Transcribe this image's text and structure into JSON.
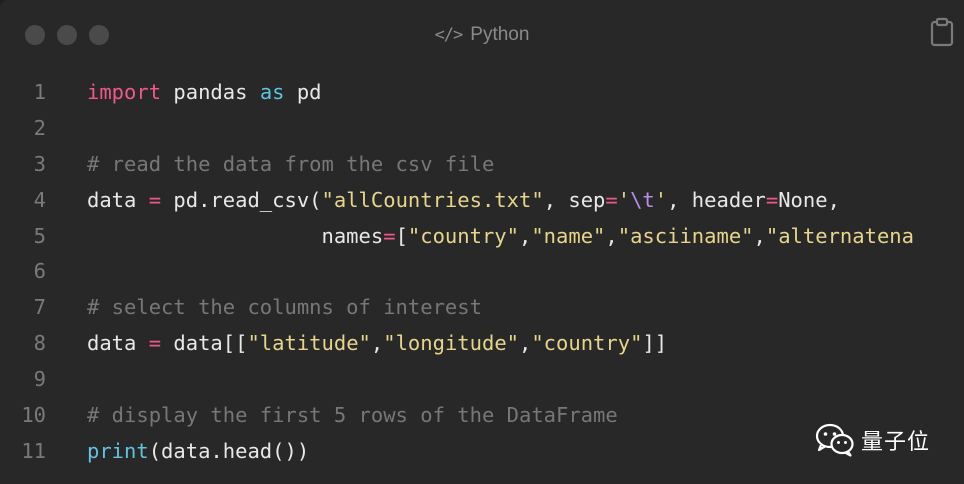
{
  "window": {
    "language": "Python",
    "code_icon": "code-icon",
    "copy_icon": "clipboard-icon"
  },
  "code": {
    "lines": [
      {
        "num": "1",
        "tokens": [
          {
            "t": "import",
            "c": "kw"
          },
          {
            "t": " pandas ",
            "c": ""
          },
          {
            "t": "as",
            "c": "kw2"
          },
          {
            "t": " pd",
            "c": ""
          }
        ]
      },
      {
        "num": "2",
        "tokens": []
      },
      {
        "num": "3",
        "tokens": [
          {
            "t": "# read the data from the csv file",
            "c": "cm"
          }
        ]
      },
      {
        "num": "4",
        "tokens": [
          {
            "t": "data ",
            "c": ""
          },
          {
            "t": "=",
            "c": "op"
          },
          {
            "t": " pd.read_csv(",
            "c": ""
          },
          {
            "t": "\"allCountries.txt\"",
            "c": "str"
          },
          {
            "t": ", sep",
            "c": ""
          },
          {
            "t": "=",
            "c": "op"
          },
          {
            "t": "'",
            "c": "str"
          },
          {
            "t": "\\t",
            "c": "esc"
          },
          {
            "t": "'",
            "c": "str"
          },
          {
            "t": ", header",
            "c": ""
          },
          {
            "t": "=",
            "c": "op"
          },
          {
            "t": "None,",
            "c": ""
          }
        ]
      },
      {
        "num": "5",
        "tokens": [
          {
            "t": "                   names",
            "c": ""
          },
          {
            "t": "=",
            "c": "op"
          },
          {
            "t": "[",
            "c": ""
          },
          {
            "t": "\"country\"",
            "c": "str"
          },
          {
            "t": ",",
            "c": ""
          },
          {
            "t": "\"name\"",
            "c": "str"
          },
          {
            "t": ",",
            "c": ""
          },
          {
            "t": "\"asciiname\"",
            "c": "str"
          },
          {
            "t": ",",
            "c": ""
          },
          {
            "t": "\"alternatena",
            "c": "str"
          }
        ]
      },
      {
        "num": "6",
        "tokens": []
      },
      {
        "num": "7",
        "tokens": [
          {
            "t": "# select the columns of interest",
            "c": "cm"
          }
        ]
      },
      {
        "num": "8",
        "tokens": [
          {
            "t": "data ",
            "c": ""
          },
          {
            "t": "=",
            "c": "op"
          },
          {
            "t": " data[[",
            "c": ""
          },
          {
            "t": "\"latitude\"",
            "c": "str"
          },
          {
            "t": ",",
            "c": ""
          },
          {
            "t": "\"longitude\"",
            "c": "str"
          },
          {
            "t": ",",
            "c": ""
          },
          {
            "t": "\"country\"",
            "c": "str"
          },
          {
            "t": "]]",
            "c": ""
          }
        ]
      },
      {
        "num": "9",
        "tokens": []
      },
      {
        "num": "10",
        "tokens": [
          {
            "t": "# display the first 5 rows of the DataFrame",
            "c": "cm"
          }
        ]
      },
      {
        "num": "11",
        "tokens": [
          {
            "t": "print",
            "c": "fn"
          },
          {
            "t": "(data.head())",
            "c": ""
          }
        ]
      }
    ]
  },
  "watermark": {
    "text": "量子位",
    "icon": "wechat-icon"
  },
  "colors": {
    "background": "#282828",
    "keyword": "#f0588c",
    "builtin": "#5ec4e0",
    "string": "#e7d58c",
    "escape": "#b78cf0",
    "comment": "#777777"
  }
}
